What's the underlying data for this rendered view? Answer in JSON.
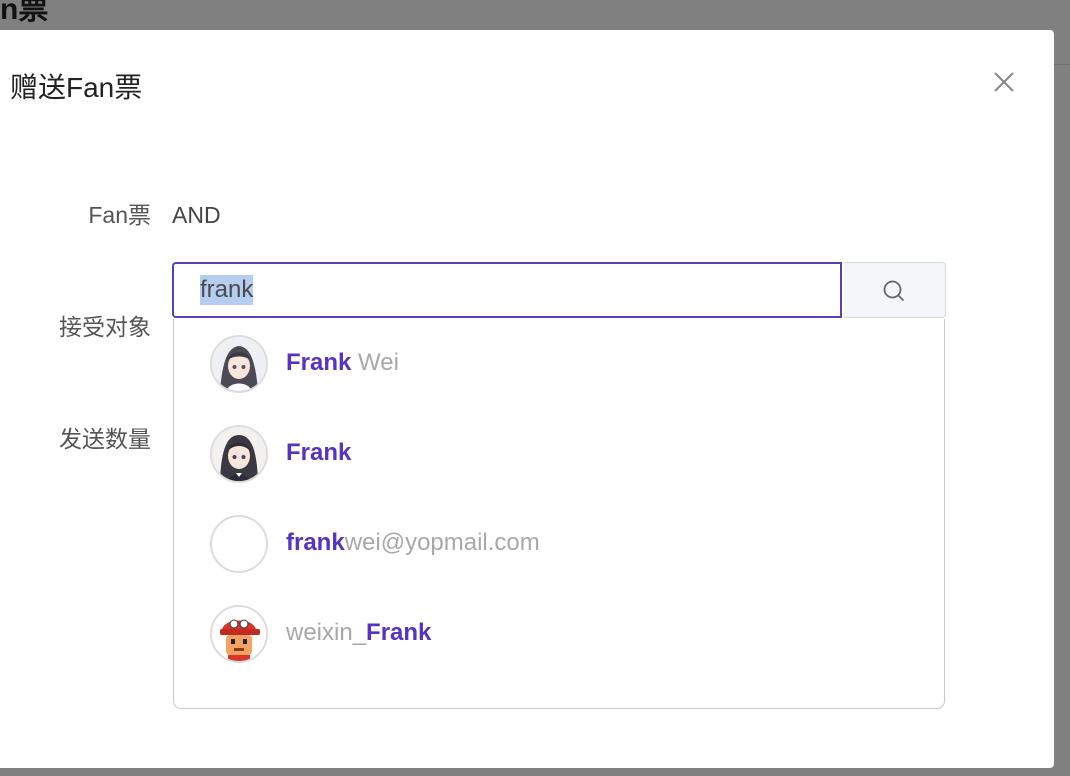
{
  "background": {
    "title_fragment": "n票"
  },
  "modal": {
    "title": "赠送Fan票",
    "fields": {
      "fan_ticket_label": "Fan票",
      "fan_ticket_value": "AND",
      "recipient_label": "接受对象",
      "quantity_label": "发送数量"
    },
    "search": {
      "value": "frank",
      "icon": "search-icon"
    },
    "suggestions": [
      {
        "match": "Frank",
        "rest": " Wei",
        "prefix": "",
        "avatar": "anime-girl-avatar"
      },
      {
        "match": "Frank",
        "rest": "",
        "prefix": "",
        "avatar": "anime-girl-avatar"
      },
      {
        "match": "frank",
        "rest": "wei@yopmail.com",
        "prefix": "",
        "avatar": "blank-avatar"
      },
      {
        "match": "Frank",
        "rest": "",
        "prefix": "weixin_",
        "avatar": "cartoon-boy-avatar"
      }
    ],
    "colors": {
      "accent": "#5533c4",
      "input_border": "#5a3fb8",
      "muted_text": "#a8a8a8"
    }
  }
}
